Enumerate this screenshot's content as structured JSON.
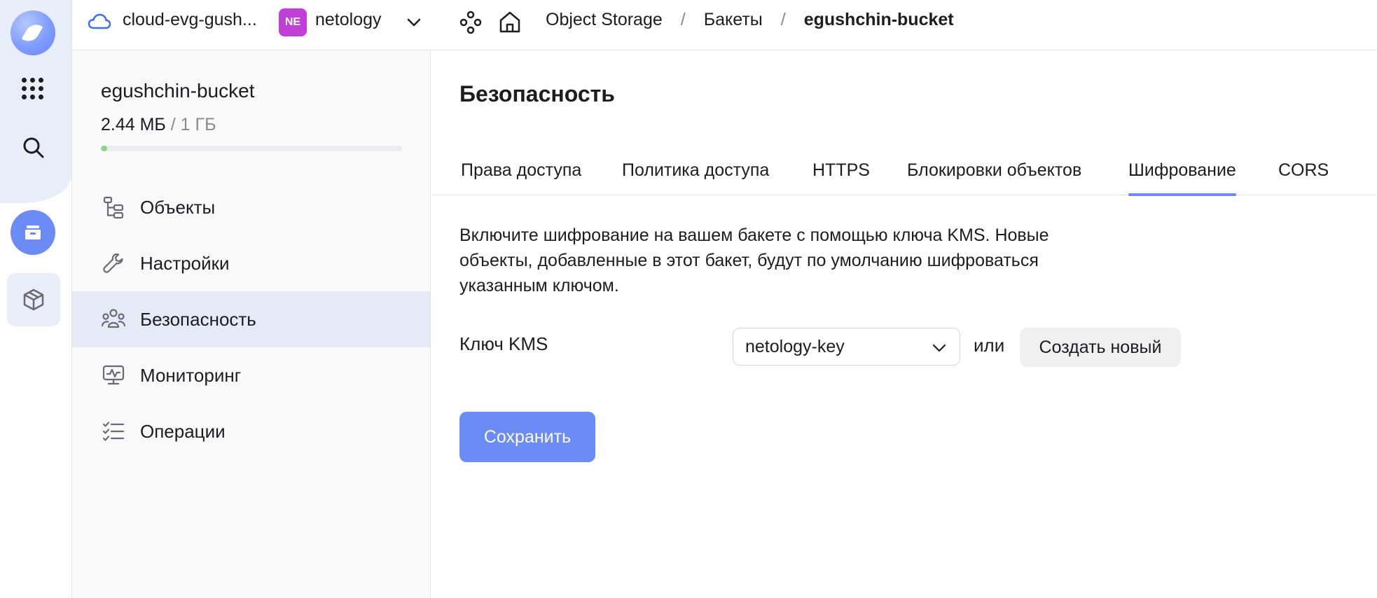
{
  "topbar": {
    "cloud_name": "cloud-evg-gush...",
    "org_badge": "NE",
    "org_name": "netology",
    "breadcrumbs": [
      "Object Storage",
      "Бакеты",
      "egushchin-bucket"
    ],
    "separator": "/"
  },
  "sidebar": {
    "bucket_name": "egushchin-bucket",
    "usage_used": "2.44 МБ",
    "usage_total": " / 1 ГБ",
    "usage_fraction": 0.0024,
    "items": [
      {
        "label": "Объекты",
        "icon": "objects-tree-icon"
      },
      {
        "label": "Настройки",
        "icon": "wrench-icon"
      },
      {
        "label": "Безопасность",
        "icon": "users-icon",
        "active": true
      },
      {
        "label": "Мониторинг",
        "icon": "monitor-icon"
      },
      {
        "label": "Операции",
        "icon": "checklist-icon"
      }
    ]
  },
  "main": {
    "title": "Безопасность",
    "tabs": [
      {
        "label": "Права доступа"
      },
      {
        "label": "Политика доступа"
      },
      {
        "label": "HTTPS"
      },
      {
        "label": "Блокировки объектов"
      },
      {
        "label": "Шифрование",
        "active": true
      },
      {
        "label": "CORS"
      }
    ],
    "description": "Включите шифрование на вашем бакете с помощью ключа KMS. Новые объекты, добавленные в этот бакет, будут по умолчанию шифроваться указанным ключом.",
    "kms_label": "Ключ KMS",
    "kms_value": "netology-key",
    "or_text": "или",
    "create_button": "Создать новый",
    "save_button": "Сохранить"
  },
  "colors": {
    "accent": "#6b8cf7",
    "rail_bg": "#e9edf8",
    "active_item_bg": "#e6eaf7",
    "org_badge": "#c03fd6",
    "usage_fill": "#8fd18f"
  }
}
